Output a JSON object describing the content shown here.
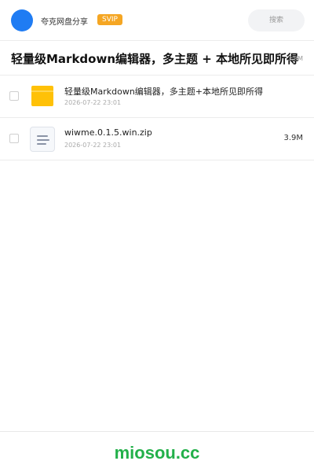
{
  "header": {
    "brand": "夸克网盘分享",
    "badge": "SVIP",
    "search_label": "搜索"
  },
  "share": {
    "title": "轻量级Markdown编辑器，多主题 + 本地所见即所得",
    "size": "3.9M"
  },
  "files": [
    {
      "name": "轻量级Markdown编辑器，多主题+本地所见即所得",
      "date": "2026-07-22 23:01",
      "size": "",
      "icon": "folder-icon"
    },
    {
      "name": "wiwme.0.1.5.win.zip",
      "date": "2026-07-22 23:01",
      "size": "3.9M",
      "icon": "file-icon"
    }
  ],
  "footer": {
    "logo": "miosou.cc"
  },
  "colors": {
    "accent": "#1f7cf3",
    "badge": "#f5a623",
    "folder": "#ffc107",
    "footer_logo": "#23b04a"
  }
}
